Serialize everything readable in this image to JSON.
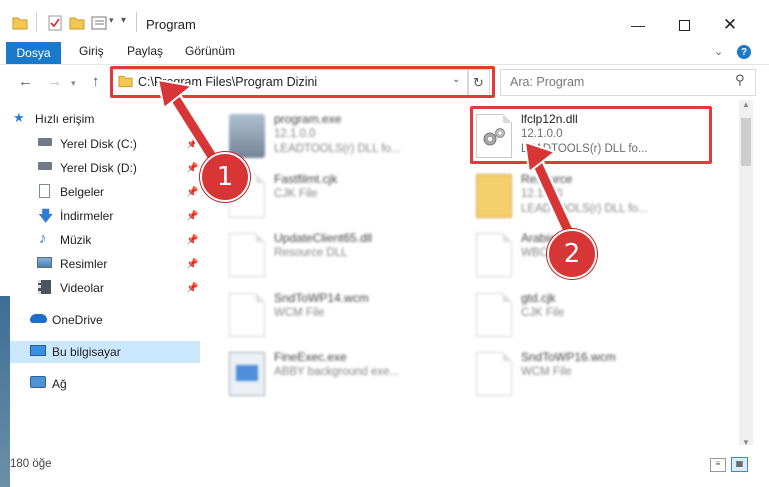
{
  "window": {
    "title": "Program"
  },
  "ribbon": {
    "tabs": [
      "Dosya",
      "Giriş",
      "Paylaş",
      "Görünüm"
    ]
  },
  "address": {
    "path": "C:\\Program Files\\Program Dizini",
    "search_placeholder": "Ara: Program"
  },
  "sidebar": {
    "items": [
      {
        "label": "Hızlı erişim",
        "icon": "star-icon",
        "pinned": false
      },
      {
        "label": "Yerel Disk (C:)",
        "icon": "drive-icon",
        "pinned": true
      },
      {
        "label": "Yerel Disk (D:)",
        "icon": "drive-icon",
        "pinned": true
      },
      {
        "label": "Belgeler",
        "icon": "documents-icon",
        "pinned": true
      },
      {
        "label": "İndirmeler",
        "icon": "download-icon",
        "pinned": true
      },
      {
        "label": "Müzik",
        "icon": "music-icon",
        "pinned": true
      },
      {
        "label": "Resimler",
        "icon": "pictures-icon",
        "pinned": true
      },
      {
        "label": "Videolar",
        "icon": "video-icon",
        "pinned": true
      },
      {
        "label": "OneDrive",
        "icon": "cloud-icon",
        "pinned": false
      },
      {
        "label": "Bu bilgisayar",
        "icon": "computer-icon",
        "pinned": false
      },
      {
        "label": "Ağ",
        "icon": "network-icon",
        "pinned": false
      }
    ]
  },
  "files": [
    {
      "name": "program.exe",
      "line2": "12.1.0.0",
      "line3": "LEADTOOLS(r) DLL fo...",
      "icon": "exe-icon",
      "blur": true
    },
    {
      "name": "lfclp12n.dll",
      "line2": "12.1.0.0",
      "line3": "LEADTOOLS(r) DLL fo...",
      "icon": "dll-gear-icon",
      "blur": false
    },
    {
      "name": "Fastfilmt.cjk",
      "line2": "CJK File",
      "line3": "",
      "icon": "doc-icon",
      "blur": true
    },
    {
      "name": "Resource",
      "line2": "12.1.0.0",
      "line3": "LEADTOOLS(r) DLL fo...",
      "icon": "folder-icon",
      "blur": true
    },
    {
      "name": "UpdateClient65.dll",
      "line2": "Resource DLL",
      "line3": "",
      "icon": "dll-icon",
      "blur": true
    },
    {
      "name": "Arabic.cjk",
      "line2": "WBC File",
      "line3": "",
      "icon": "doc-icon",
      "blur": true
    },
    {
      "name": "SndToWP14.wcm",
      "line2": "WCM File",
      "line3": "",
      "icon": "doc-icon",
      "blur": true
    },
    {
      "name": "gtd.cjk",
      "line2": "CJK File",
      "line3": "",
      "icon": "doc-icon",
      "blur": true
    },
    {
      "name": "FineExec.exe",
      "line2": "ABBY background exe...",
      "line3": "",
      "icon": "app-icon",
      "blur": true
    },
    {
      "name": "SndToWP16.wcm",
      "line2": "WCM File",
      "line3": "",
      "icon": "doc-icon",
      "blur": true
    }
  ],
  "status": {
    "count_text": "180 öğe"
  },
  "annotations": {
    "badge1": "1",
    "badge2": "2",
    "highlight_color": "#e03a3a"
  },
  "colors": {
    "accent": "#1979ca",
    "selection": "#cce8ff"
  }
}
